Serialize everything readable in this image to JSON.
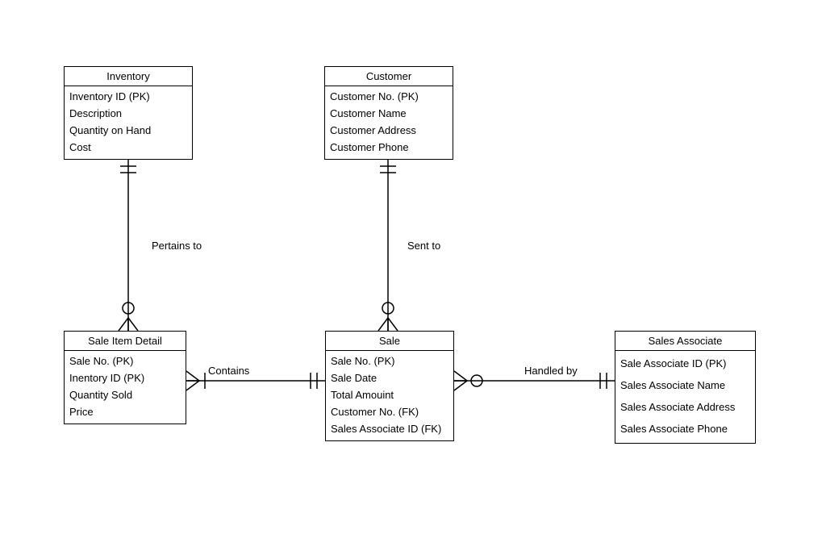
{
  "entities": {
    "inventory": {
      "title": "Inventory",
      "attrs": [
        "Inventory ID (PK)",
        "Description",
        "Quantity on Hand",
        "Cost"
      ]
    },
    "customer": {
      "title": "Customer",
      "attrs": [
        "Customer No. (PK)",
        "Customer Name",
        "Customer Address",
        "Customer Phone"
      ]
    },
    "sale_item_detail": {
      "title": "Sale Item Detail",
      "attrs": [
        "Sale No. (PK)",
        "Inentory ID (PK)",
        "Quantity Sold",
        "Price"
      ]
    },
    "sale": {
      "title": "Sale",
      "attrs": [
        "Sale No. (PK)",
        "Sale Date",
        "Total Amouint",
        "Customer No. (FK)",
        "Sales Associate ID (FK)"
      ]
    },
    "sales_associate": {
      "title": "Sales Associate",
      "attrs": [
        "Sale Associate ID (PK)",
        "Sales Associate Name",
        "Sales Associate Address",
        "Sales Associate Phone"
      ]
    }
  },
  "relations": {
    "pertains_to": "Pertains to",
    "sent_to": "Sent to",
    "contains": "Contains",
    "handled_by": "Handled by"
  }
}
